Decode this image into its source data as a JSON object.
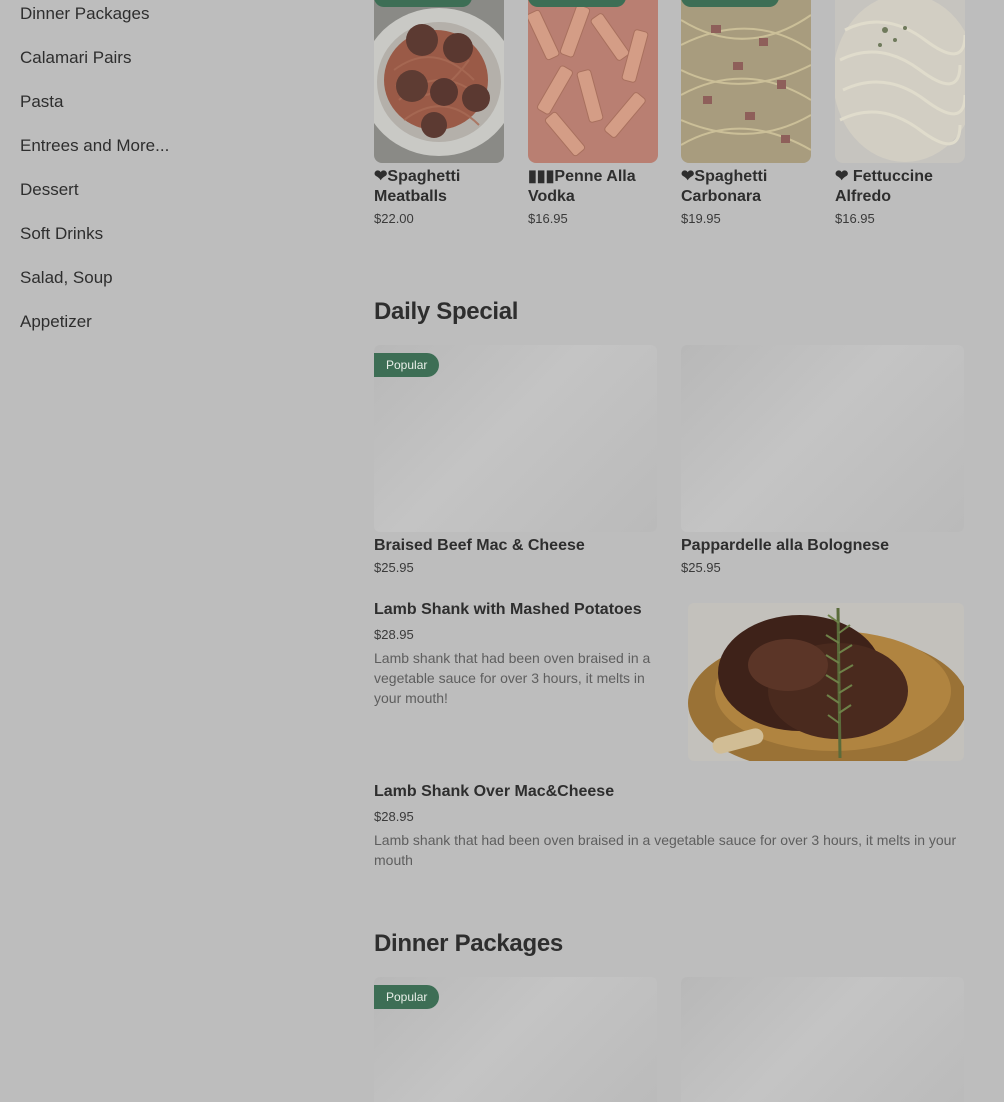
{
  "sidebar": {
    "items": [
      {
        "label": "Dinner Packages"
      },
      {
        "label": "Calamari Pairs"
      },
      {
        "label": "Pasta"
      },
      {
        "label": "Entrees and More..."
      },
      {
        "label": "Dessert"
      },
      {
        "label": "Soft Drinks"
      },
      {
        "label": "Salad, Soup"
      },
      {
        "label": "Appetizer"
      }
    ]
  },
  "pasta": {
    "items": [
      {
        "name": "❤Spaghetti Meatballs",
        "price": "$22.00"
      },
      {
        "name": "▮▮▮Penne Alla Vodka",
        "price": "$16.95"
      },
      {
        "name": "❤Spaghetti Carbonara",
        "price": "$19.95"
      },
      {
        "name": "❤ Fettuccine Alfredo",
        "price": "$16.95"
      }
    ]
  },
  "daily_special": {
    "title": "Daily Special",
    "cards": [
      {
        "name": "Braised Beef Mac & Cheese",
        "price": "$25.95",
        "badge": "Popular"
      },
      {
        "name": "Pappardelle alla Bolognese",
        "price": "$25.95"
      }
    ],
    "list": [
      {
        "name": "Lamb Shank with Mashed Potatoes",
        "price": "$28.95",
        "desc": "Lamb shank that had been oven braised in a vegetable sauce for over 3 hours, it melts in your mouth!"
      },
      {
        "name": "Lamb Shank Over Mac&Cheese",
        "price": "$28.95",
        "desc": "Lamb shank that had been oven braised in a vegetable sauce for over 3 hours, it melts in your mouth"
      }
    ]
  },
  "dinner_packages": {
    "title": "Dinner Packages",
    "badge": "Popular"
  },
  "colors": {
    "overlay_bg": "#bdbdbd",
    "badge_green": "#3d6e55",
    "text_dark": "#2e2e2e",
    "text_muted": "#5e5e5e"
  }
}
